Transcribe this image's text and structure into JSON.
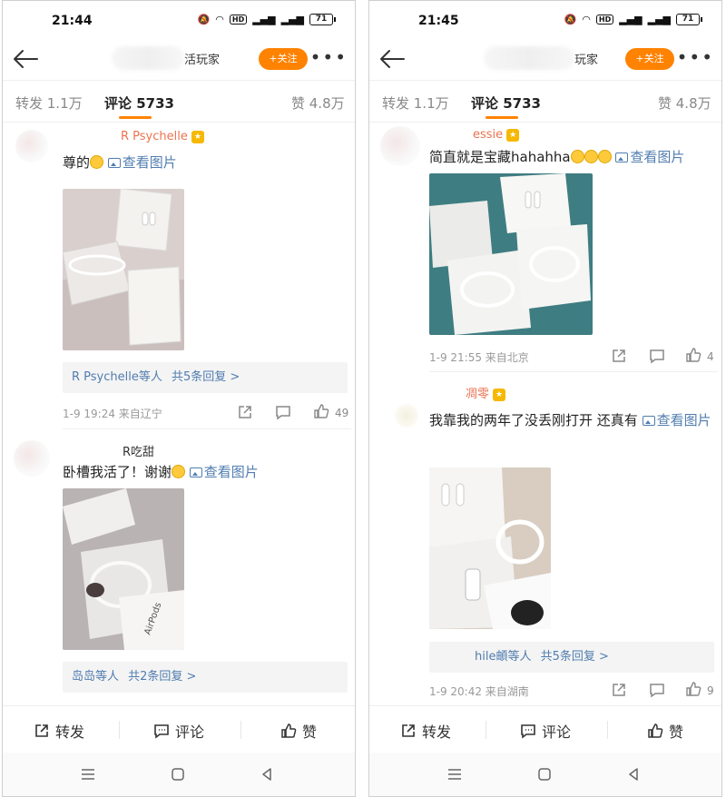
{
  "left": {
    "status": {
      "time": "21:44",
      "battery": "71"
    },
    "header": {
      "title_suffix": "活玩家",
      "follow_label": "+关注"
    },
    "tabs": {
      "repost": "转发 1.1万",
      "comments": "评论 5733",
      "likes": "赞 4.8万"
    },
    "comments": [
      {
        "user": "R Psychelle",
        "text": "尊的",
        "see_pic": "查看图片",
        "reply_who": "R Psychelle等人",
        "reply_count": "共5条回复 >",
        "time_loc": "1-9 19:24  来自辽宁",
        "likes": "49"
      },
      {
        "user": "R吃甜",
        "text": "卧槽我活了！谢谢",
        "see_pic": "查看图片",
        "reply_who": "岛岛等人",
        "reply_count": "共2条回复 >"
      }
    ],
    "bottom": {
      "repost": "转发",
      "comment": "评论",
      "like": "赞"
    }
  },
  "right": {
    "status": {
      "time": "21:45",
      "battery": "71"
    },
    "header": {
      "title_suffix": "玩家",
      "follow_label": "+关注"
    },
    "tabs": {
      "repost": "转发 1.1万",
      "comments": "评论 5733",
      "likes": "赞 4.8万"
    },
    "comments": [
      {
        "user": "essie",
        "text": "简直就是宝藏hahahha",
        "see_pic": "查看图片",
        "time_loc": "1-9 21:55  来自北京",
        "likes": "4"
      },
      {
        "user": "凋零",
        "text": "我靠我的两年了没丢刚打开 还真有",
        "see_pic": "查看",
        "see_pic_2": "图片",
        "reply_who": "hile頔等人",
        "reply_count": "共5条回复 >",
        "time_loc": "1-9 20:42  来自湖南",
        "likes": "9"
      }
    ],
    "bottom": {
      "repost": "转发",
      "comment": "评论",
      "like": "赞"
    }
  },
  "colors": {
    "accent": "#ff8200",
    "link": "#507daf",
    "username": "#eb7350"
  }
}
